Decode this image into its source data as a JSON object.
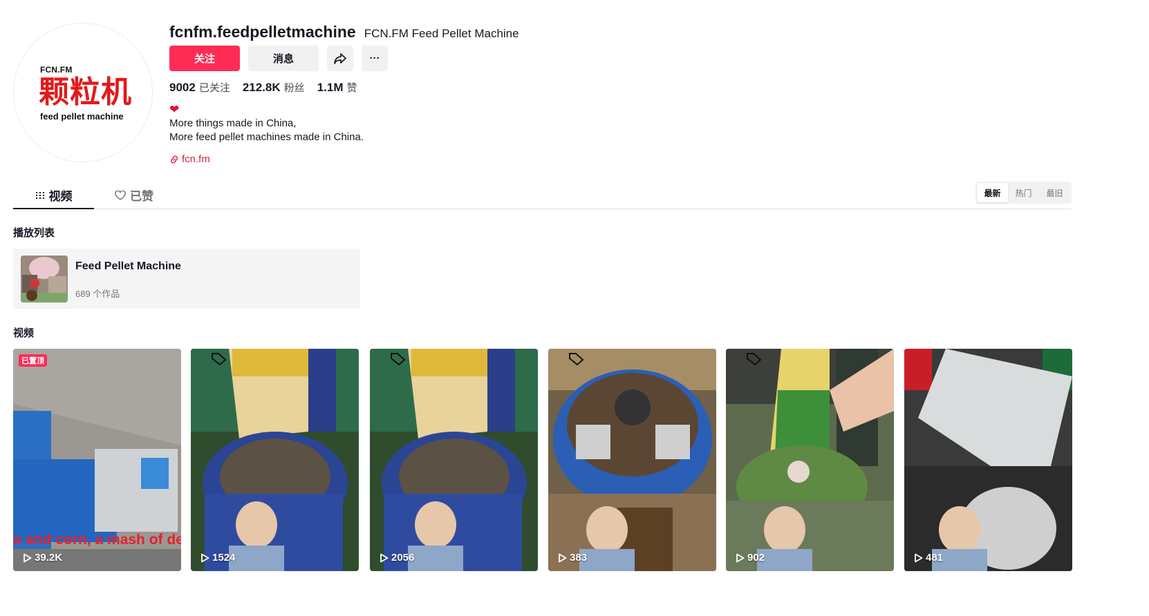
{
  "profile": {
    "unique_id": "fcnfm.feedpelletmachine",
    "nickname": "FCN.FM Feed Pellet Machine",
    "avatar_top": "FCN.FM",
    "avatar_main": "颗粒机",
    "avatar_bottom": "feed pellet machine",
    "follow_label": "关注",
    "message_label": "消息",
    "share_icon": "share-icon",
    "more_label": "···",
    "stats": [
      {
        "num": "9002",
        "label": "已关注"
      },
      {
        "num": "212.8K",
        "label": "粉丝"
      },
      {
        "num": "1.1M",
        "label": "赞"
      }
    ],
    "bio_heart": "❤",
    "bio_lines": [
      "More things made in China,",
      "More feed pellet machines made in China."
    ],
    "link": "fcn.fm"
  },
  "tabs": {
    "videos": "视频",
    "liked": "已赞"
  },
  "sort": {
    "options": [
      "最新",
      "热门",
      "最旧"
    ],
    "active": "最新"
  },
  "playlist_section": {
    "title": "播放列表",
    "item": {
      "name": "Feed Pellet Machine",
      "count": "689 个作品"
    }
  },
  "videos_section": {
    "title": "视频",
    "pinned_label": "已置顶",
    "first_caption": "w and corn, a mash of del",
    "items": [
      {
        "views": "39.2K"
      },
      {
        "views": "1524"
      },
      {
        "views": "2056"
      },
      {
        "views": "383"
      },
      {
        "views": "902"
      },
      {
        "views": "481"
      }
    ]
  },
  "colors": {
    "accent": "#fe2c55",
    "link": "#d4283e"
  }
}
